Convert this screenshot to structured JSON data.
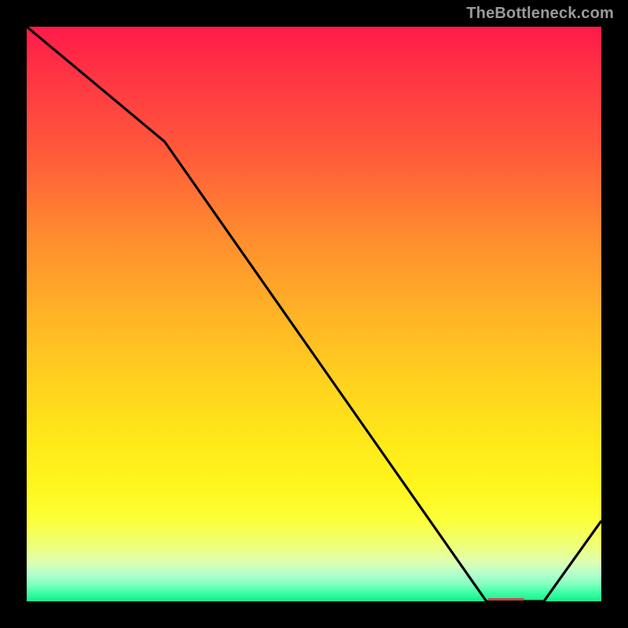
{
  "attribution": "TheBottleneck.com",
  "chart_data": {
    "type": "line",
    "title": "",
    "xlabel": "",
    "ylabel": "",
    "xlim": [
      0,
      100
    ],
    "ylim": [
      0,
      100
    ],
    "series": [
      {
        "name": "bottleneck-curve",
        "x": [
          0,
          24,
          80,
          90,
          100
        ],
        "values": [
          100,
          80,
          0,
          0,
          14
        ]
      }
    ],
    "annotations": [
      {
        "name": "min-region-marker",
        "x": 84,
        "y": 1.5
      }
    ],
    "gradient_stops": [
      {
        "pct": 0,
        "color": "#ff1a49"
      },
      {
        "pct": 50,
        "color": "#ffd21e"
      },
      {
        "pct": 90,
        "color": "#f0ff74"
      },
      {
        "pct": 100,
        "color": "#16ec8c"
      }
    ]
  },
  "marker_glyph": "▬▬▬▬▬"
}
